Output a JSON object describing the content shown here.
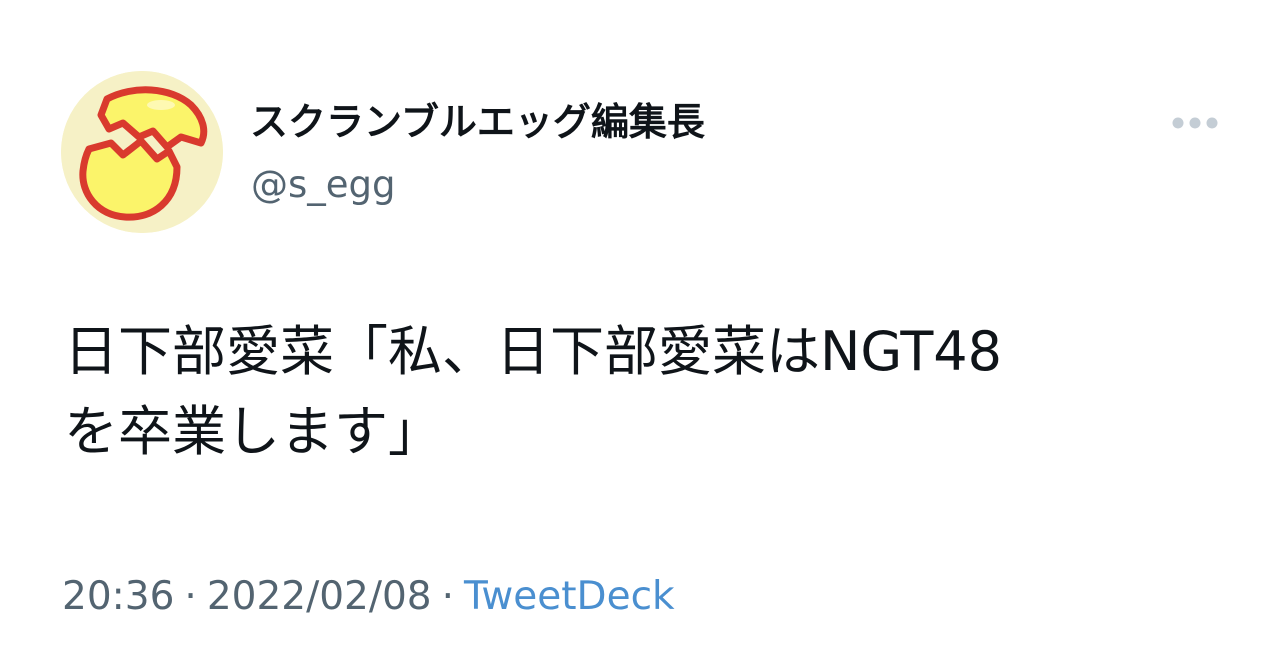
{
  "tweet": {
    "author": {
      "display_name": "スクランブルエッグ編集長",
      "handle": "@s_egg",
      "avatar_icon": "cracked-egg-icon"
    },
    "more_icon": "more-horizontal-icon",
    "text_line_1": "日下部愛菜「私、日下部愛菜はNGT48",
    "text_line_2": "を卒業します」",
    "time": "20:36",
    "separator": "·",
    "date": "2022/02/08",
    "source": "TweetDeck"
  },
  "colors": {
    "text_primary": "#0f1419",
    "text_secondary": "#536471",
    "source_link": "#4a8fd0",
    "avatar_background": "#f6f1c6",
    "egg_fill": "#fbf46a",
    "egg_outline": "#d93a2e"
  }
}
